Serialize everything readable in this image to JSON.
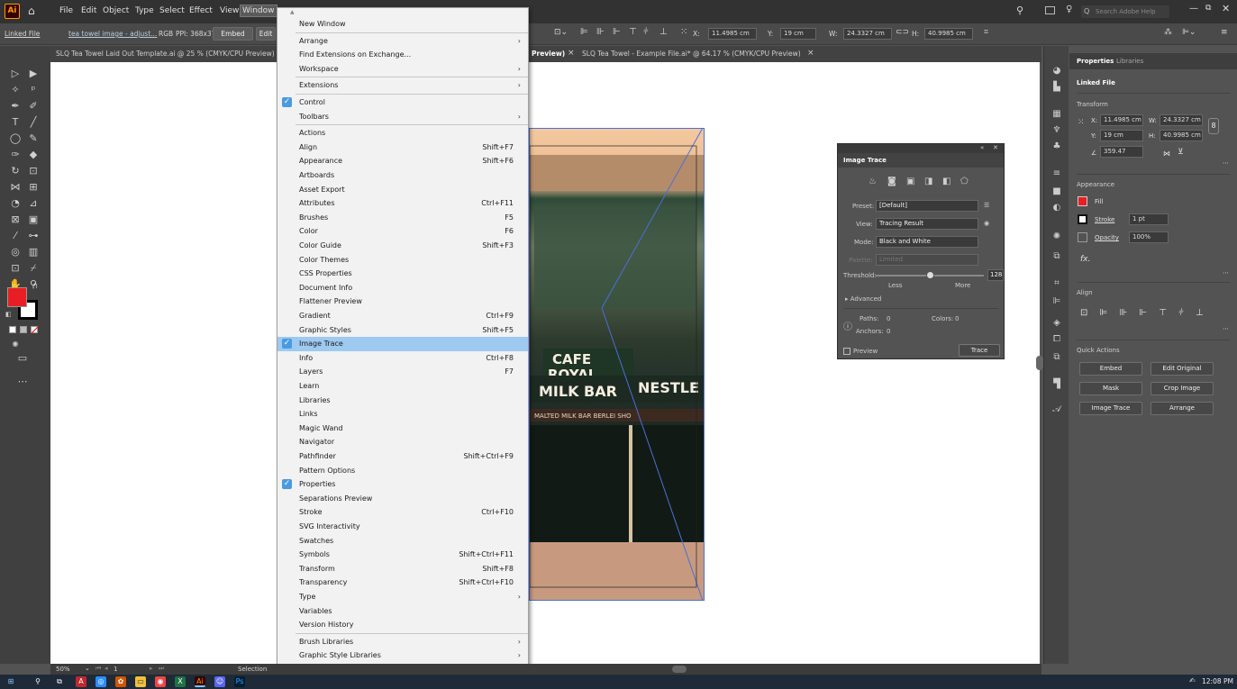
{
  "menubar": {
    "items": [
      "File",
      "Edit",
      "Object",
      "Type",
      "Select",
      "Effect",
      "View",
      "Window"
    ],
    "search_placeholder": "Search Adobe Help"
  },
  "controlbar": {
    "linked_file": "Linked File",
    "file_name": "tea towel image - adjust...",
    "mode": "RGB",
    "ppi": "PPI: 368x372",
    "embed": "Embed",
    "edit": "Edit",
    "x_label": "X:",
    "x_value": "11.4985 cm",
    "y_label": "Y:",
    "y_value": "19 cm",
    "w_label": "W:",
    "w_value": "24.3327 cm",
    "h_label": "H:",
    "h_value": "40.9985 cm"
  },
  "tabs": {
    "doc1": "SLQ Tea Towel Laid Out Template.ai @ 25 % (CMYK/CPU Preview)",
    "doc2_suffix": "Preview)",
    "doc3": "SLQ Tea Towel - Example File.ai* @ 64.17 % (CMYK/CPU Preview)",
    "close": "×"
  },
  "window_menu": {
    "items": [
      {
        "label": "New Window",
        "shortcut": "",
        "arrow": false,
        "checked": false,
        "sep_after": true
      },
      {
        "label": "Arrange",
        "shortcut": "",
        "arrow": true,
        "checked": false
      },
      {
        "label": "Find Extensions on Exchange...",
        "shortcut": "",
        "arrow": false,
        "checked": false
      },
      {
        "label": "Workspace",
        "shortcut": "",
        "arrow": true,
        "checked": false,
        "sep_after": true
      },
      {
        "label": "Extensions",
        "shortcut": "",
        "arrow": true,
        "checked": false,
        "sep_after": true
      },
      {
        "label": "Control",
        "shortcut": "",
        "arrow": false,
        "checked": true
      },
      {
        "label": "Toolbars",
        "shortcut": "",
        "arrow": true,
        "checked": false,
        "sep_after": true
      },
      {
        "label": "Actions",
        "shortcut": "",
        "arrow": false,
        "checked": false
      },
      {
        "label": "Align",
        "shortcut": "Shift+F7",
        "arrow": false,
        "checked": false
      },
      {
        "label": "Appearance",
        "shortcut": "Shift+F6",
        "arrow": false,
        "checked": false
      },
      {
        "label": "Artboards",
        "shortcut": "",
        "arrow": false,
        "checked": false
      },
      {
        "label": "Asset Export",
        "shortcut": "",
        "arrow": false,
        "checked": false
      },
      {
        "label": "Attributes",
        "shortcut": "Ctrl+F11",
        "arrow": false,
        "checked": false
      },
      {
        "label": "Brushes",
        "shortcut": "F5",
        "arrow": false,
        "checked": false
      },
      {
        "label": "Color",
        "shortcut": "F6",
        "arrow": false,
        "checked": false
      },
      {
        "label": "Color Guide",
        "shortcut": "Shift+F3",
        "arrow": false,
        "checked": false
      },
      {
        "label": "Color Themes",
        "shortcut": "",
        "arrow": false,
        "checked": false
      },
      {
        "label": "CSS Properties",
        "shortcut": "",
        "arrow": false,
        "checked": false
      },
      {
        "label": "Document Info",
        "shortcut": "",
        "arrow": false,
        "checked": false
      },
      {
        "label": "Flattener Preview",
        "shortcut": "",
        "arrow": false,
        "checked": false
      },
      {
        "label": "Gradient",
        "shortcut": "Ctrl+F9",
        "arrow": false,
        "checked": false
      },
      {
        "label": "Graphic Styles",
        "shortcut": "Shift+F5",
        "arrow": false,
        "checked": false
      },
      {
        "label": "Image Trace",
        "shortcut": "",
        "arrow": false,
        "checked": true,
        "highlighted": true
      },
      {
        "label": "Info",
        "shortcut": "Ctrl+F8",
        "arrow": false,
        "checked": false
      },
      {
        "label": "Layers",
        "shortcut": "F7",
        "arrow": false,
        "checked": false
      },
      {
        "label": "Learn",
        "shortcut": "",
        "arrow": false,
        "checked": false
      },
      {
        "label": "Libraries",
        "shortcut": "",
        "arrow": false,
        "checked": false
      },
      {
        "label": "Links",
        "shortcut": "",
        "arrow": false,
        "checked": false
      },
      {
        "label": "Magic Wand",
        "shortcut": "",
        "arrow": false,
        "checked": false
      },
      {
        "label": "Navigator",
        "shortcut": "",
        "arrow": false,
        "checked": false
      },
      {
        "label": "Pathfinder",
        "shortcut": "Shift+Ctrl+F9",
        "arrow": false,
        "checked": false
      },
      {
        "label": "Pattern Options",
        "shortcut": "",
        "arrow": false,
        "checked": false
      },
      {
        "label": "Properties",
        "shortcut": "",
        "arrow": false,
        "checked": true
      },
      {
        "label": "Separations Preview",
        "shortcut": "",
        "arrow": false,
        "checked": false
      },
      {
        "label": "Stroke",
        "shortcut": "Ctrl+F10",
        "arrow": false,
        "checked": false
      },
      {
        "label": "SVG Interactivity",
        "shortcut": "",
        "arrow": false,
        "checked": false
      },
      {
        "label": "Swatches",
        "shortcut": "",
        "arrow": false,
        "checked": false
      },
      {
        "label": "Symbols",
        "shortcut": "Shift+Ctrl+F11",
        "arrow": false,
        "checked": false
      },
      {
        "label": "Transform",
        "shortcut": "Shift+F8",
        "arrow": false,
        "checked": false
      },
      {
        "label": "Transparency",
        "shortcut": "Shift+Ctrl+F10",
        "arrow": false,
        "checked": false
      },
      {
        "label": "Type",
        "shortcut": "",
        "arrow": true,
        "checked": false
      },
      {
        "label": "Variables",
        "shortcut": "",
        "arrow": false,
        "checked": false
      },
      {
        "label": "Version History",
        "shortcut": "",
        "arrow": false,
        "checked": false,
        "sep_after": true
      },
      {
        "label": "Brush Libraries",
        "shortcut": "",
        "arrow": true,
        "checked": false
      },
      {
        "label": "Graphic Style Libraries",
        "shortcut": "",
        "arrow": true,
        "checked": false
      }
    ]
  },
  "image_trace": {
    "title": "Image Trace",
    "preset_label": "Preset:",
    "preset_value": "[Default]",
    "view_label": "View:",
    "view_value": "Tracing Result",
    "mode_label": "Mode:",
    "mode_value": "Black and White",
    "palette_label": "Palette:",
    "palette_value": "Limited",
    "threshold_label": "Threshold:",
    "threshold_value": "128",
    "threshold_fraction": 0.5,
    "less": "Less",
    "more": "More",
    "advanced": "Advanced",
    "paths_label": "Paths:",
    "paths_value": "0",
    "colors_label": "Colors:",
    "colors_value": "0",
    "anchors_label": "Anchors:",
    "anchors_value": "0",
    "preview": "Preview",
    "trace": "Trace"
  },
  "properties": {
    "tab_properties": "Properties",
    "tab_libraries": "Libraries",
    "linked_file": "Linked File",
    "transform": "Transform",
    "x_label": "X:",
    "x_value": "11.4985 cm",
    "y_label": "Y:",
    "y_value": "19 cm",
    "w_label": "W:",
    "w_value": "24.3327 cm",
    "h_label": "H:",
    "h_value": "40.9985 cm",
    "angle_value": "359.47",
    "appearance": "Appearance",
    "fill": "Fill",
    "stroke": "Stroke",
    "stroke_value": "1 pt",
    "opacity": "Opacity",
    "opacity_value": "100%",
    "fx": "fx.",
    "align": "Align",
    "quick_actions": "Quick Actions",
    "embed": "Embed",
    "edit_original": "Edit Original",
    "mask": "Mask",
    "crop_image": "Crop Image",
    "image_trace": "Image Trace",
    "arrange": "Arrange"
  },
  "statusbar": {
    "zoom": "50%",
    "page": "1",
    "tool": "Selection"
  },
  "taskbar": {
    "time": "12:08 PM"
  },
  "colors": {
    "fill": "#e81e25",
    "menu_highlight": "#9ec9f0",
    "check": "#4b9ae0",
    "selection": "#4a6fd8"
  }
}
